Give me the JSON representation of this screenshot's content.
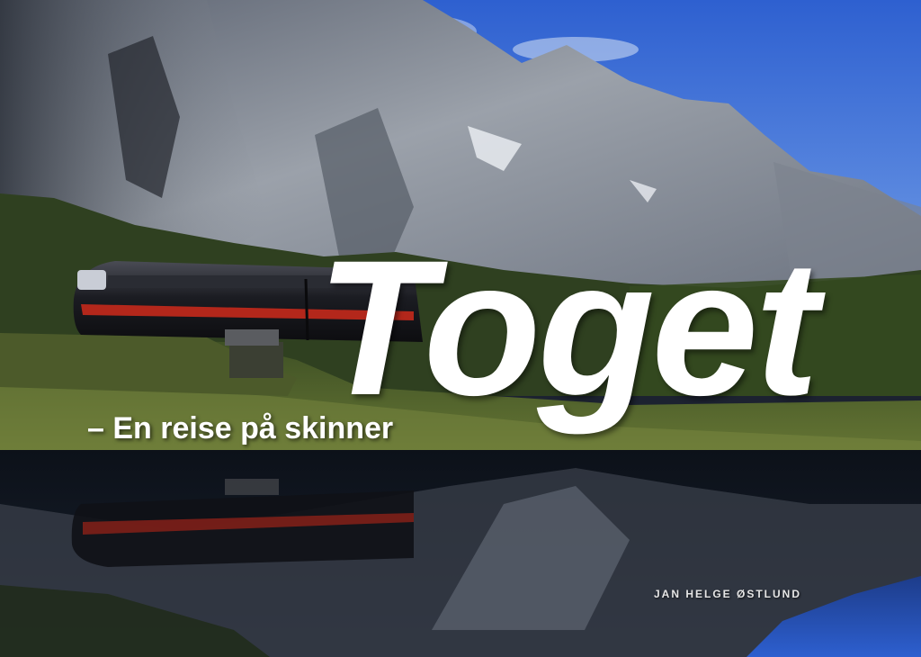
{
  "cover": {
    "title": "Toget",
    "subtitle": "– En reise på skinner",
    "author": "JAN HELGE ØSTLUND"
  },
  "colors": {
    "sky": "#3f6fd6",
    "mountain": "#8a8f98",
    "grass": "#5a6e2c",
    "water": "#121821",
    "train_red": "#b3271b",
    "title_text": "#ffffff"
  },
  "scene_elements": [
    "mountain",
    "sky",
    "train",
    "meadow",
    "lake-reflection"
  ]
}
